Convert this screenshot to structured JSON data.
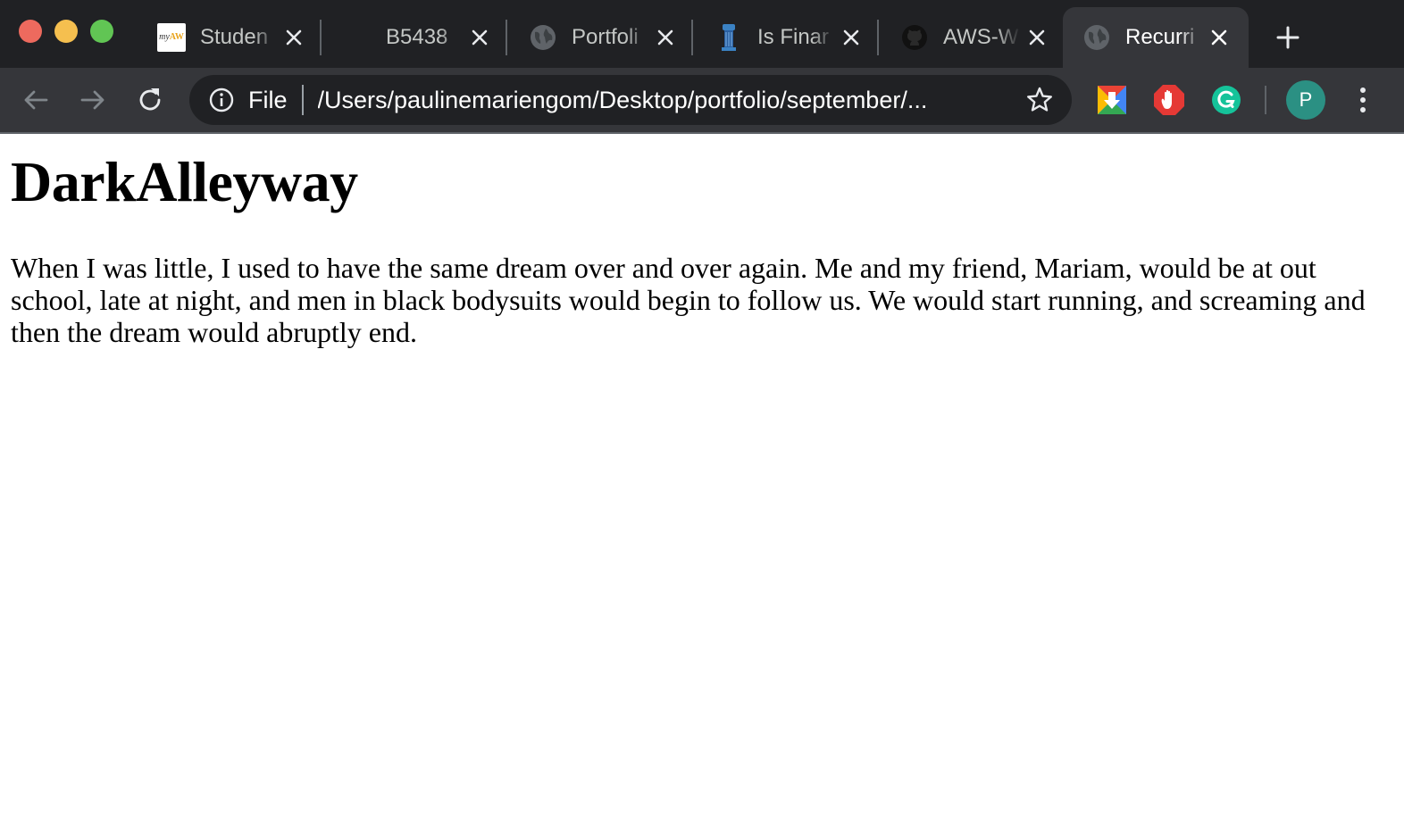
{
  "window": {
    "traffic_lights": [
      "close",
      "minimize",
      "maximize"
    ]
  },
  "tabs": [
    {
      "title": "Studen",
      "favicon": "myaw-logo",
      "favicon_text": "myAW",
      "active": false
    },
    {
      "title": "B5438",
      "favicon": "blank",
      "active": false
    },
    {
      "title": "Portfoli",
      "favicon": "globe-icon",
      "active": false
    },
    {
      "title": "Is Finar",
      "favicon": "tower-icon",
      "active": false
    },
    {
      "title": "AWS-W",
      "favicon": "github-icon",
      "active": false
    },
    {
      "title": "Recurri",
      "favicon": "globe-icon",
      "active": true
    }
  ],
  "toolbar": {
    "scheme_label": "File",
    "url": "/Users/paulinemariengom/Desktop/portfolio/september/...",
    "extensions": [
      "google-drive-download-icon",
      "adblock-hand-icon",
      "grammarly-icon"
    ],
    "profile_initial": "P"
  },
  "page": {
    "heading": "DarkAlleyway",
    "paragraph": "When I was little, I used to have the same dream over and over again. Me and my friend, Mariam, would be at out school, late at night, and men in black bodysuits would begin to follow us. We would start running, and screaming and then the dream would abruptly end."
  },
  "colors": {
    "tab_strip": "#202124",
    "toolbar": "#35363a",
    "omnibox": "#202124",
    "profile": "#2b9083",
    "page_background": "#ffffff"
  }
}
